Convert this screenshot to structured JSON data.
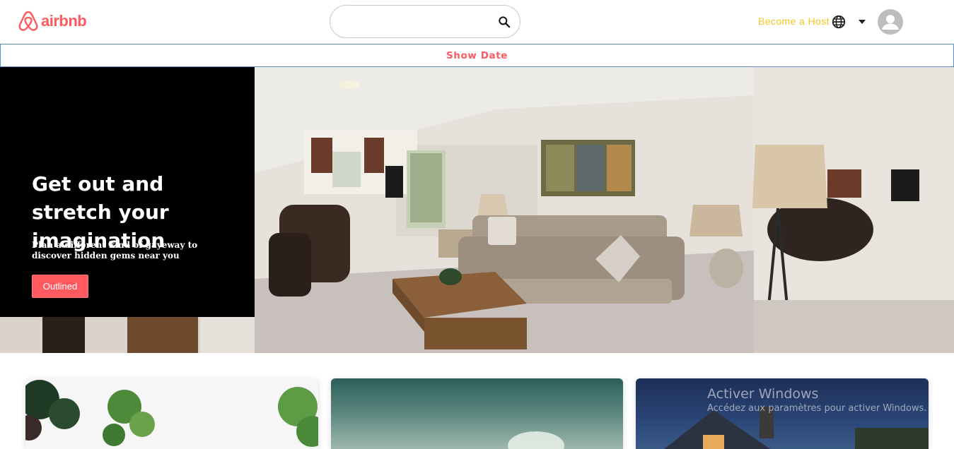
{
  "header": {
    "logo_text": "airbnb",
    "search": {
      "placeholder": "",
      "value": ""
    },
    "host_link": "Become a Host",
    "icons": [
      "airbnb-logo-icon",
      "search-icon",
      "globe-icon",
      "caret-down-icon",
      "user-avatar-icon"
    ]
  },
  "date_bar": {
    "label": "Show Date"
  },
  "hero": {
    "title": "Get out and stretch your imagination",
    "subtitle": "Plan a different kind of gayeway to discover hidden gems near you",
    "button_label": "Outlined"
  },
  "cards": [
    {
      "image": "plants-image"
    },
    {
      "image": "sky-image"
    },
    {
      "image": "house-image"
    }
  ],
  "watermark": {
    "title": "Activer Windows",
    "subtitle": "Accédez aux paramètres pour activer Windows."
  },
  "colors": {
    "brand": "#ff5a5f",
    "host_link": "#f3c623",
    "date_bar_border": "#5b8ec9",
    "hero_panel": "#000000"
  }
}
